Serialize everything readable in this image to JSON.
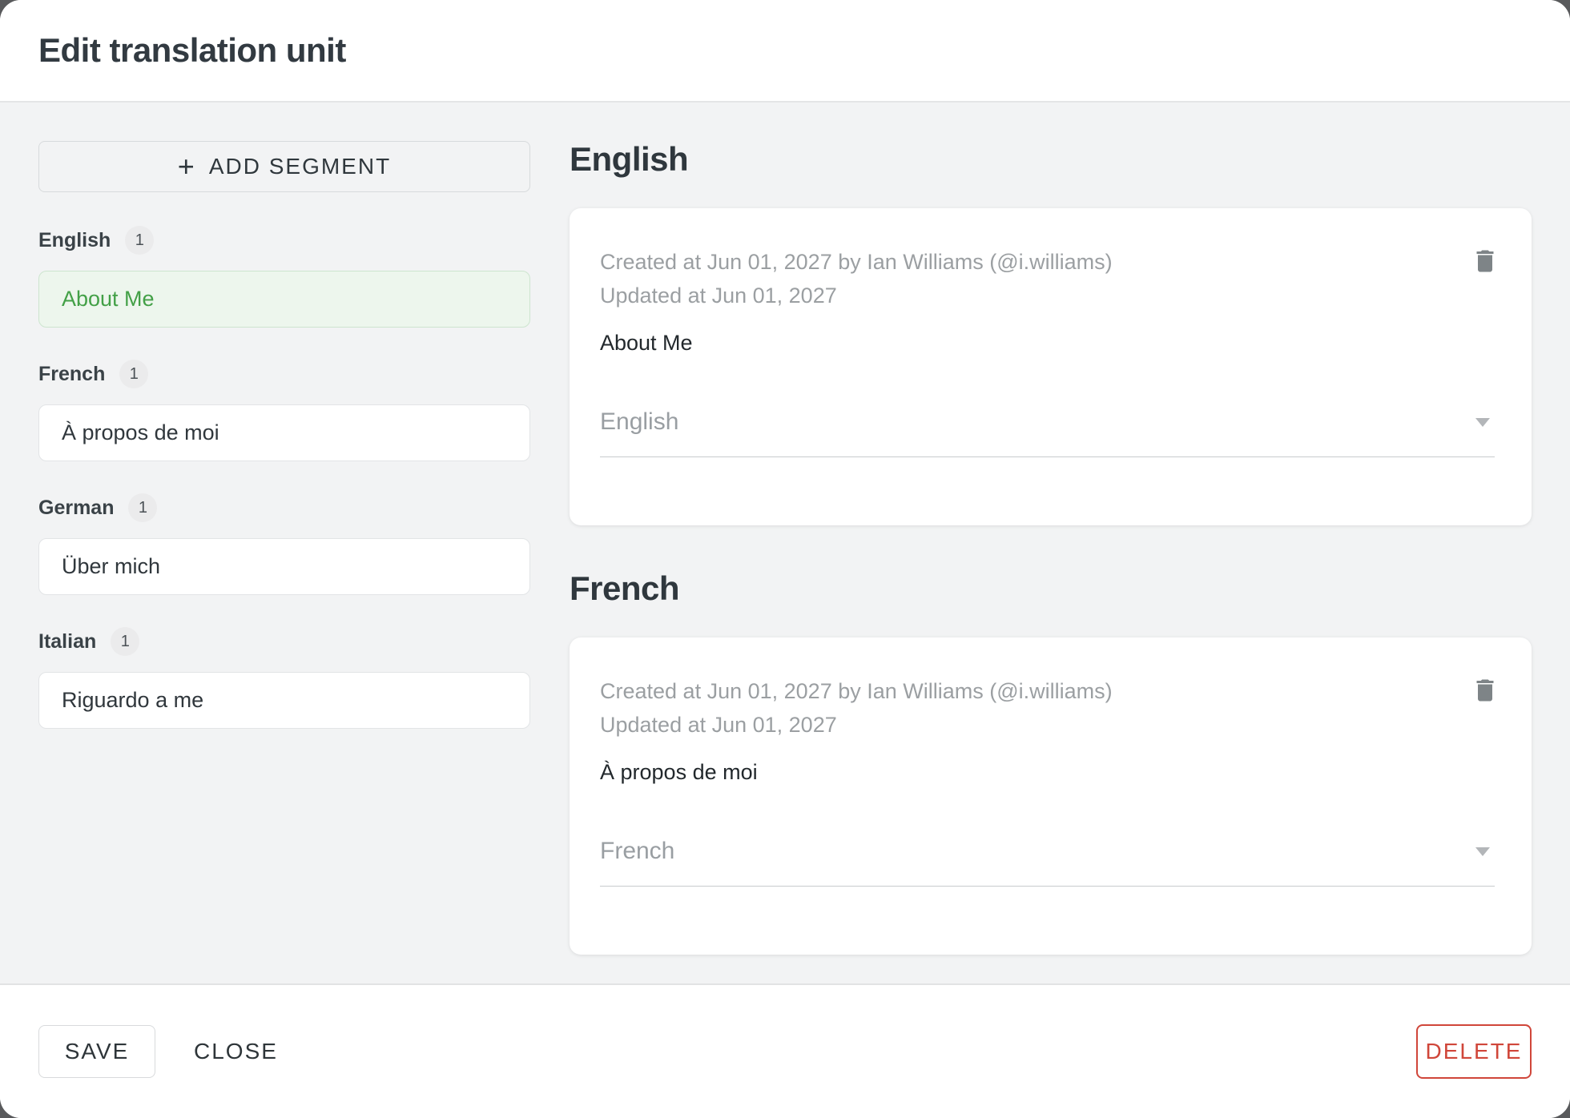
{
  "dialog": {
    "title": "Edit translation unit"
  },
  "colors": {
    "accent_green": "#43a047",
    "danger_red": "#d0463a",
    "body_background": "#f2f3f4",
    "backdrop": "#595a5c"
  },
  "sidebar": {
    "add_segment_label": "ADD SEGMENT",
    "plus_icon": "+",
    "groups": [
      {
        "label": "English",
        "count": "1",
        "items": [
          {
            "text": "About Me",
            "selected": true
          }
        ]
      },
      {
        "label": "French",
        "count": "1",
        "items": [
          {
            "text": "À propos de moi",
            "selected": false
          }
        ]
      },
      {
        "label": "German",
        "count": "1",
        "items": [
          {
            "text": "Über mich",
            "selected": false
          }
        ]
      },
      {
        "label": "Italian",
        "count": "1",
        "items": [
          {
            "text": "Riguardo a me",
            "selected": false
          }
        ]
      }
    ]
  },
  "main": {
    "sections": [
      {
        "heading": "English",
        "card": {
          "created_line": "Created at Jun 01, 2027 by Ian Williams (@i.williams)",
          "updated_line": "Updated at Jun 01, 2027",
          "text": "About Me",
          "language_select_value": "English"
        }
      },
      {
        "heading": "French",
        "card": {
          "created_line": "Created at Jun 01, 2027 by Ian Williams (@i.williams)",
          "updated_line": "Updated at Jun 01, 2027",
          "text": "À propos de moi",
          "language_select_value": "French"
        }
      }
    ]
  },
  "footer": {
    "save_label": "SAVE",
    "close_label": "CLOSE",
    "delete_label": "DELETE"
  }
}
